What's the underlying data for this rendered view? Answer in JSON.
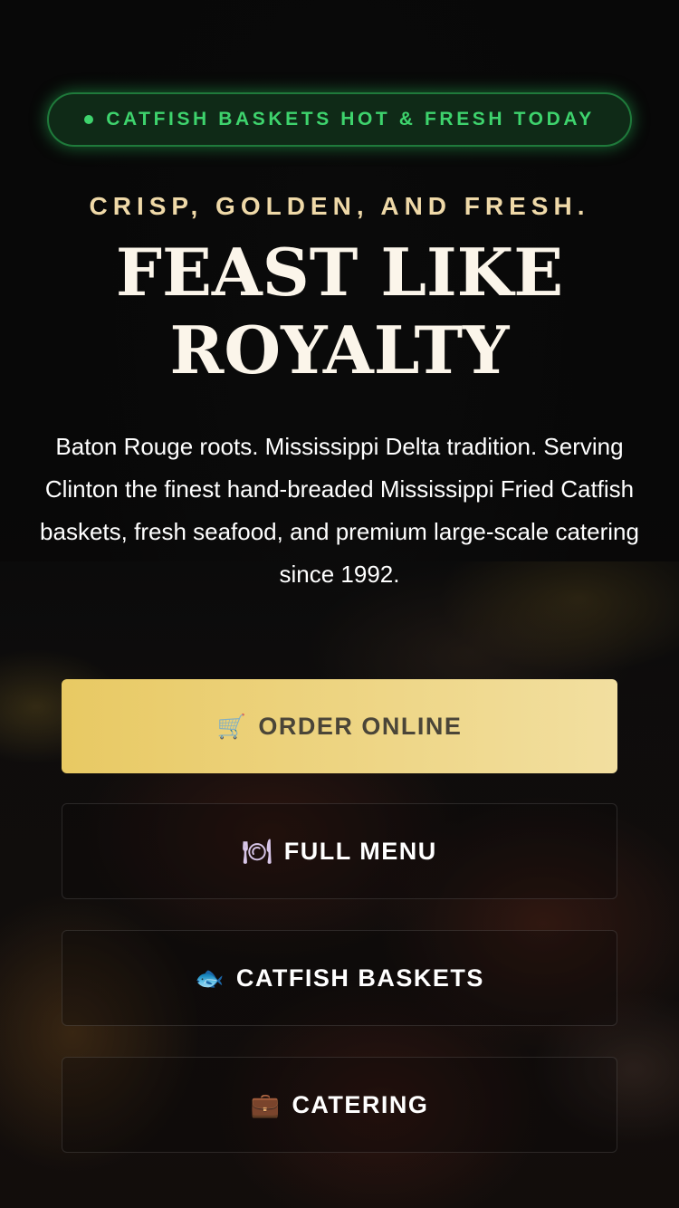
{
  "badge": {
    "label": "CATFISH BASKETS HOT & FRESH TODAY"
  },
  "hero": {
    "tagline": "CRISP, GOLDEN, AND FRESH.",
    "headline_line1": "FEAST LIKE",
    "headline_line2": "ROYALTY",
    "description": "Baton Rouge roots. Mississippi Delta tradition. Serving Clinton the finest hand-breaded Mississippi Fried Catfish baskets, fresh seafood, and premium large-scale catering since 1992."
  },
  "buttons": {
    "order_online": {
      "icon": "cart-icon",
      "glyph": "🛒",
      "label": "ORDER ONLINE"
    },
    "full_menu": {
      "icon": "plate-icon",
      "glyph": "🍽",
      "label": "FULL MENU"
    },
    "catfish_baskets": {
      "icon": "fish-icon",
      "glyph": "🐟",
      "label": "CATFISH BASKETS"
    },
    "catering": {
      "icon": "briefcase-icon",
      "glyph": "💼",
      "label": "CATERING"
    }
  },
  "colors": {
    "badge_green": "#3ed36d",
    "gold_button": "#e8c963",
    "tagline_cream": "#efd9a8"
  }
}
